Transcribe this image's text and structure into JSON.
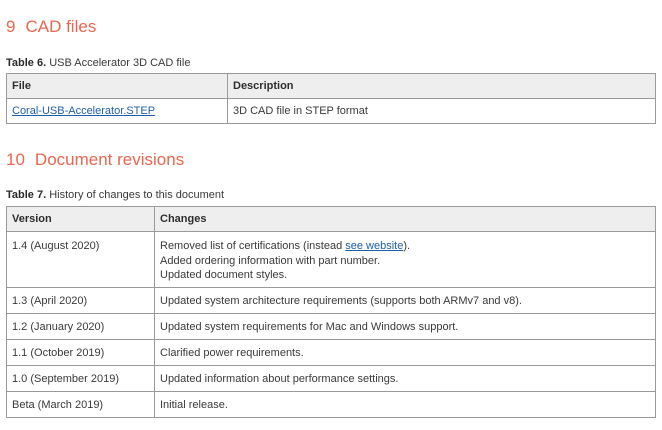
{
  "sections": [
    {
      "number": "9",
      "title": "CAD files"
    },
    {
      "number": "10",
      "title": "Document revisions"
    }
  ],
  "table6": {
    "caption_label": "Table 6.",
    "caption_text": "USB Accelerator 3D CAD file",
    "headers": [
      "File",
      "Description"
    ],
    "rows": [
      {
        "file": "Coral-USB-Accelerator.STEP",
        "description": "3D CAD file in STEP format"
      }
    ]
  },
  "table7": {
    "caption_label": "Table 7.",
    "caption_text": "History of changes to this document",
    "headers": [
      "Version",
      "Changes"
    ],
    "rows": [
      {
        "version": "1.4 (August 2020)",
        "line1_before": "Removed list of certifications (instead ",
        "line1_link": "see website",
        "line1_after": ").",
        "line2": "Added ordering information with part number.",
        "line3": "Updated document styles."
      },
      {
        "version": "1.3 (April 2020)",
        "changes": "Updated system architecture requirements (supports both ARMv7 and v8)."
      },
      {
        "version": "1.2 (January 2020)",
        "changes": "Updated system requirements for Mac and Windows support."
      },
      {
        "version": "1.1 (October 2019)",
        "changes": "Clarified power requirements."
      },
      {
        "version": "1.0 (September 2019)",
        "changes": "Updated information about performance settings."
      },
      {
        "version": "Beta (March 2019)",
        "changes": "Initial release."
      }
    ]
  },
  "colors": {
    "heading": "#e8674f",
    "link": "#1f5fa8",
    "header_bg": "#eeeeee",
    "border": "#9a9a9a"
  }
}
